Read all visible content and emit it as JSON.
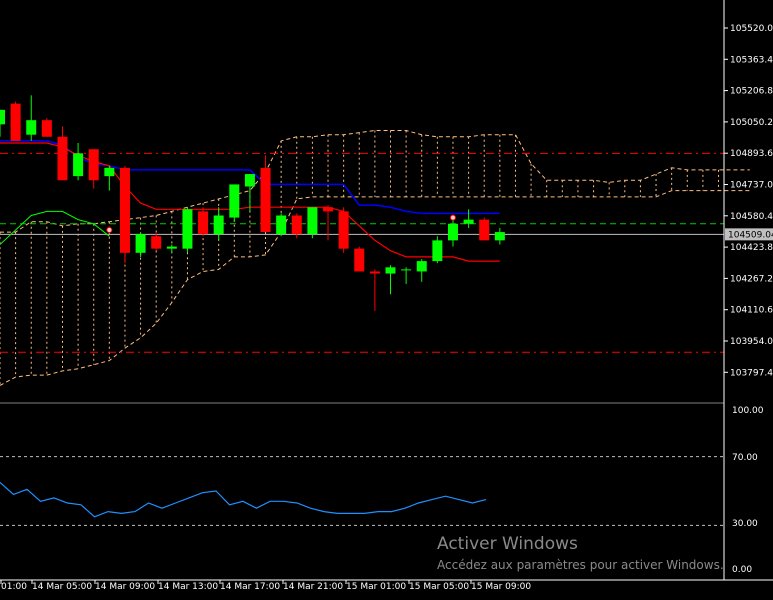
{
  "chart_data": {
    "type": "candlestick",
    "colors": {
      "background": "#000000",
      "bull": "#00ff00",
      "bear": "#ff0000",
      "kijun": "#0000ff",
      "tenkan": "#ff0000",
      "chikou": "#00ff00",
      "cloud": "#ffbf80",
      "level_line": "#ff0000",
      "signal_line": "#00cc00",
      "bid_line": "#c0c0c0",
      "oscillator": "#1e90ff",
      "axis": "#ffffff"
    },
    "price_axis": {
      "ticks": [
        "105520.01",
        "105363.41",
        "105206.81",
        "105050.21",
        "104893.61",
        "104737.01",
        "104580.41",
        "104423.81",
        "104267.21",
        "104110.61",
        "103954.01",
        "103797.41"
      ],
      "current_price": "104509.04",
      "range": [
        103700,
        105640
      ]
    },
    "time_axis": {
      "ticks": [
        "01:00",
        "14 Mar 05:00",
        "14 Mar 09:00",
        "14 Mar 13:00",
        "14 Mar 17:00",
        "14 Mar 21:00",
        "15 Mar 01:00",
        "15 Mar 05:00",
        "15 Mar 09:00"
      ]
    },
    "candles": [
      {
        "o": 105040,
        "h": 105110,
        "l": 104980,
        "c": 105110
      },
      {
        "o": 105140,
        "h": 105150,
        "l": 104960,
        "c": 104960
      },
      {
        "o": 104990,
        "h": 105180,
        "l": 104960,
        "c": 105060
      },
      {
        "o": 105060,
        "h": 105070,
        "l": 104980,
        "c": 104980
      },
      {
        "o": 104980,
        "h": 105030,
        "l": 104770,
        "c": 104770
      },
      {
        "o": 104790,
        "h": 104950,
        "l": 104770,
        "c": 104900
      },
      {
        "o": 104920,
        "h": 104920,
        "l": 104730,
        "c": 104770
      },
      {
        "o": 104790,
        "h": 104840,
        "l": 104720,
        "c": 104830
      },
      {
        "o": 104830,
        "h": 104840,
        "l": 104370,
        "c": 104420
      },
      {
        "o": 104420,
        "h": 104520,
        "l": 104400,
        "c": 104510
      },
      {
        "o": 104500,
        "h": 104520,
        "l": 104430,
        "c": 104440
      },
      {
        "o": 104440,
        "h": 104460,
        "l": 104420,
        "c": 104450
      },
      {
        "o": 104440,
        "h": 104640,
        "l": 104420,
        "c": 104630
      },
      {
        "o": 104620,
        "h": 104640,
        "l": 104500,
        "c": 104510
      },
      {
        "o": 104510,
        "h": 104640,
        "l": 104480,
        "c": 104600
      },
      {
        "o": 104590,
        "h": 104680,
        "l": 104570,
        "c": 104750
      },
      {
        "o": 104740,
        "h": 104800,
        "l": 104620,
        "c": 104800
      },
      {
        "o": 104830,
        "h": 104890,
        "l": 104520,
        "c": 104520
      },
      {
        "o": 104510,
        "h": 104610,
        "l": 104500,
        "c": 104600
      },
      {
        "o": 104600,
        "h": 104610,
        "l": 104490,
        "c": 104510
      },
      {
        "o": 104510,
        "h": 104640,
        "l": 104490,
        "c": 104640
      },
      {
        "o": 104640,
        "h": 104650,
        "l": 104480,
        "c": 104620
      },
      {
        "o": 104620,
        "h": 104640,
        "l": 104420,
        "c": 104440
      },
      {
        "o": 104440,
        "h": 104450,
        "l": 104330,
        "c": 104330
      },
      {
        "o": 104330,
        "h": 104340,
        "l": 104140,
        "c": 104320
      },
      {
        "o": 104320,
        "h": 104360,
        "l": 104220,
        "c": 104350
      },
      {
        "o": 104340,
        "h": 104350,
        "l": 104270,
        "c": 104340
      },
      {
        "o": 104330,
        "h": 104390,
        "l": 104280,
        "c": 104380
      },
      {
        "o": 104380,
        "h": 104500,
        "l": 104370,
        "c": 104480
      },
      {
        "o": 104480,
        "h": 104580,
        "l": 104450,
        "c": 104560
      },
      {
        "o": 104560,
        "h": 104630,
        "l": 104540,
        "c": 104580
      },
      {
        "o": 104580,
        "h": 104590,
        "l": 104480,
        "c": 104480
      },
      {
        "o": 104480,
        "h": 104540,
        "l": 104460,
        "c": 104520
      }
    ],
    "tenkan": [
      104950,
      104950,
      104950,
      104950,
      104930,
      104890,
      104860,
      104840,
      104740,
      104660,
      104630,
      104630,
      104630,
      104630,
      104630,
      104630,
      104640,
      104640,
      104640,
      104640,
      104640,
      104640,
      104620,
      104550,
      104480,
      104430,
      104400,
      104400,
      104400,
      104400,
      104380,
      104380,
      104380
    ],
    "kijun": [
      104960,
      104960,
      104960,
      104960,
      104940,
      104880,
      104850,
      104840,
      104820,
      104820,
      104820,
      104820,
      104820,
      104820,
      104820,
      104820,
      104820,
      104750,
      104750,
      104750,
      104750,
      104750,
      104750,
      104650,
      104650,
      104640,
      104620,
      104610,
      104610,
      104610,
      104610,
      104610,
      104610
    ],
    "cloud_a": [
      104520,
      104520,
      104570,
      104570,
      104550,
      104560,
      104560,
      104570,
      104580,
      104590,
      104600,
      104620,
      104640,
      104660,
      104680,
      104700,
      104720,
      104810,
      104960,
      104980,
      104980,
      104990,
      104990,
      105000,
      105010,
      105010,
      105010,
      104990,
      104980,
      104980,
      104980,
      104990,
      104990,
      104990,
      104850,
      104770,
      104770,
      104770,
      104770,
      104760,
      104770,
      104770,
      104800,
      104830,
      104820,
      104820,
      104820,
      104820,
      104820
    ],
    "cloud_b": [
      103780,
      103820,
      103830,
      103830,
      103850,
      103860,
      103880,
      103900,
      103960,
      104010,
      104080,
      104180,
      104290,
      104330,
      104340,
      104400,
      104400,
      104410,
      104520,
      104680,
      104690,
      104690,
      104690,
      104690,
      104690,
      104690,
      104690,
      104690,
      104690,
      104690,
      104690,
      104690,
      104690,
      104690,
      104690,
      104690,
      104690,
      104690,
      104690,
      104690,
      104690,
      104690,
      104690,
      104720,
      104720,
      104720,
      104720,
      104720,
      104720
    ],
    "chikou": [
      104460,
      104530,
      104600,
      104620,
      104620,
      104580,
      104560,
      104500
    ],
    "levels": {
      "upper": 104900,
      "lower": 103940,
      "signal": 104560
    },
    "markers": [
      104530,
      104590
    ],
    "oscillator": {
      "ticks": [
        "100.00",
        "70.00",
        "30.00",
        "0.00"
      ],
      "levels": [
        70,
        30
      ],
      "values": [
        55,
        48,
        51,
        44,
        46,
        43,
        42,
        35,
        38,
        37,
        38,
        43,
        40,
        43,
        46,
        49,
        50,
        42,
        44,
        40,
        44,
        44,
        43,
        40,
        38,
        37,
        37,
        37,
        38,
        38,
        40,
        43,
        45,
        47,
        45,
        43,
        45
      ]
    }
  },
  "watermark": {
    "title": "Activer Windows",
    "subtitle": "Accédez aux paramètres pour activer Windows."
  }
}
